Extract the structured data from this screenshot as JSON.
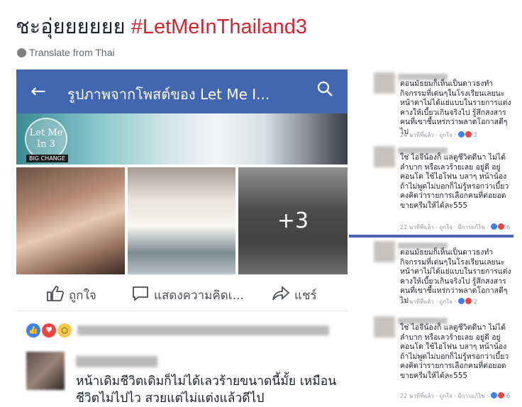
{
  "headline": {
    "text": "ชะอุ่ยยยยยย",
    "hashtag": "#LetMeInThailand3"
  },
  "translate": {
    "label": "Translate from Thai",
    "icon": "globe-icon"
  },
  "post": {
    "topbar": {
      "title": "รูปภาพจากโพสต์ของ Let Me I...",
      "back_icon": "back-arrow-icon",
      "search_icon": "search-icon",
      "color": "#4267b2"
    },
    "banner": {
      "logo_text": "Let Me In 3",
      "badge": "BIG CHANGE"
    },
    "photos": {
      "more_count": "+3"
    },
    "actions": {
      "like": "ถูกใจ",
      "comment": "แสดงความคิดเ...",
      "share": "แชร์"
    },
    "reactions": [
      "like-icon",
      "love-icon",
      "wow-icon"
    ],
    "comment": {
      "text": "หน้าเดิมชีวิตเดิมก็ไม่ได้เลวร้ายขนาดนี้มั้ย เหมือนชีวิตไม่ไปไว สวยแต่ไม่แต่งแล้วดีไป"
    }
  },
  "right_comments": [
    {
      "text": "ตอนมัธยมก็เห็นเป็นดาวธงทำกิจกรรมที่เด่นๆในโรงเรียนเลยนะ หน้าตาไม่ได้แย่แบบในรายการแต่งคางให้เบี้ยวเกินจริงไป รู้สึกสงสารคนที่เขาชี้แหร่กว่าพลาดโอกาสดีๆไป",
      "time": "24 นาทีที่แล้ว",
      "like": "ถูกใจ",
      "count": "2"
    },
    {
      "text": "ใช่ ไอจีน้องก็ แลดูชีวิตดีนา ไม่ได้ลำบาก หรือเลวร้ายเลย อยู่ดี อยู่คอนโด ใช้ไอโฟน บลาๆ หน้าน้องถ้าไม่พูดไม่บอกก็ไม่รู้หรอกว่าเบี้ยว คงคิดว่ารายการเลือกคนที่ต่อยอดขายครีมให้ได้ละ555",
      "time": "22 นาทีที่แล้ว",
      "like": "ถูกใจ",
      "reply": "มีการแก้ไข",
      "count": "6"
    },
    {
      "text": "ตอนมัธยมก็เห็นเป็นดาวธงทำกิจกรรมที่เด่นๆในโรงเรียนเลยนะ หน้าตาไม่ได้แย่แบบในรายการแต่งคางให้เบี้ยวเกินจริงไป รู้สึกสงสารคนที่เขาชี้แหร่กว่าพลาดโอกาสดีๆไป",
      "time": "24 นาทีที่แล้ว",
      "like": "ถูกใจ",
      "count": "2"
    },
    {
      "text": "ใช่ ไอจีน้องก็ แลดูชีวิตดีนา ไม่ได้ลำบาก หรือเลวร้ายเลย อยู่ดี อยู่คอนโด ใช้ไอโฟน บลาๆ หน้าน้องถ้าไม่พูดไม่บอกก็ไม่รู้หรอกว่าเบี้ยว คงคิดว่ารายการเลือกคนที่ต่อยอดขายครีมให้ได้ละ555",
      "time": "22 นาทีที่แล้ว",
      "like": "ถูกใจ",
      "reply": "มีการแก้ไข",
      "count": "6"
    }
  ]
}
